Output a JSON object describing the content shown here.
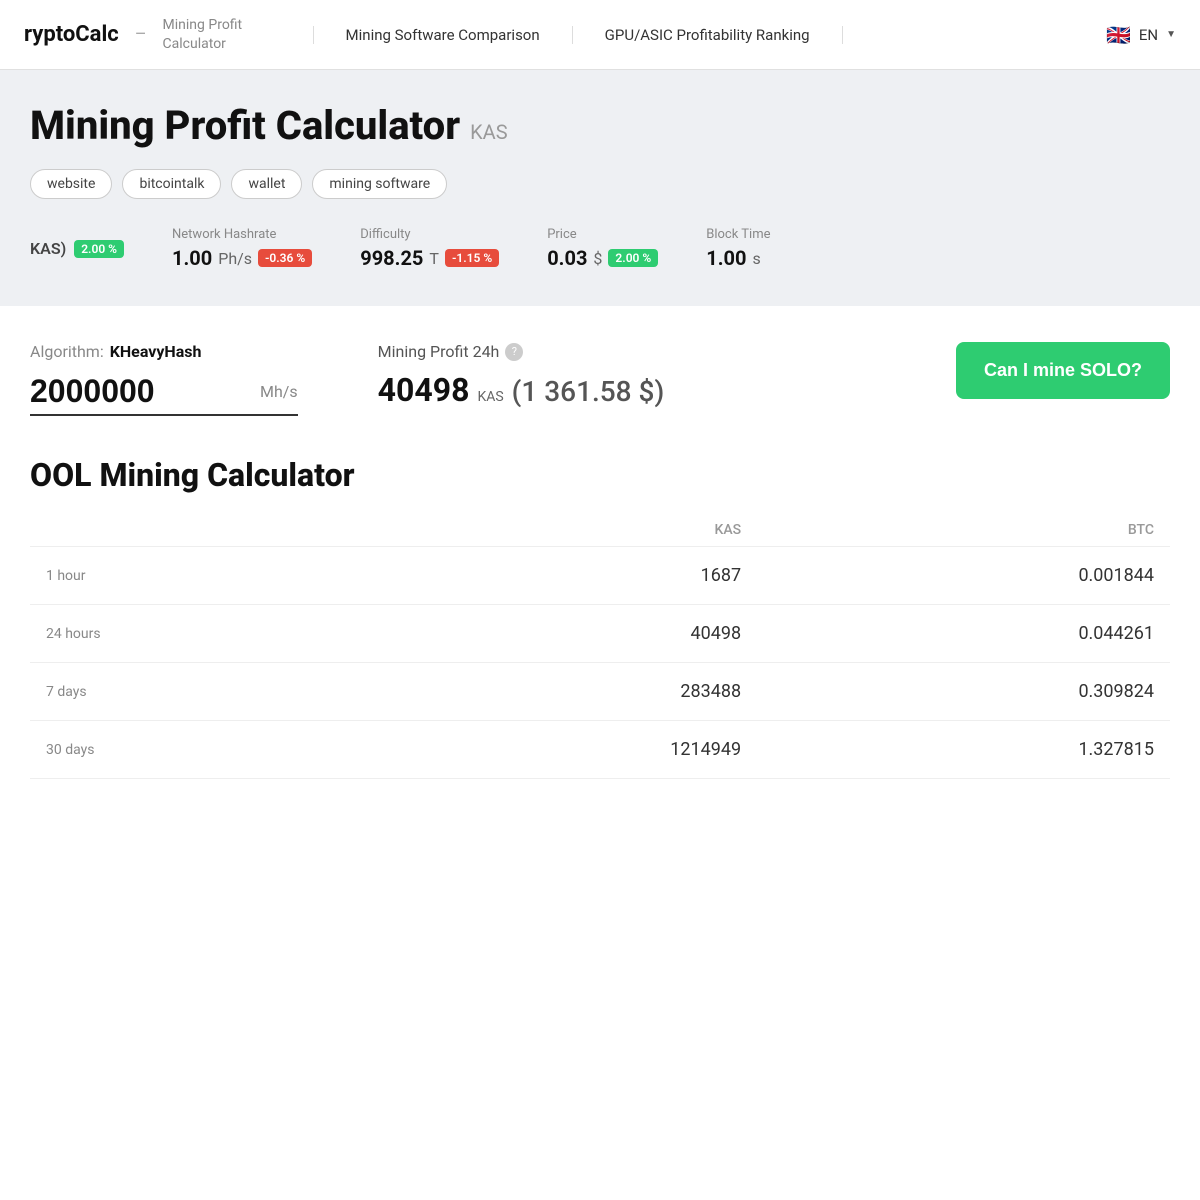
{
  "header": {
    "logo": "ryptoCalc",
    "logo_separator": "–",
    "logo_subtitle": "Mining Profit Calculator",
    "nav": [
      {
        "label": "Mining Software Comparison"
      },
      {
        "label": "GPU/ASIC Profitability Ranking"
      }
    ],
    "lang_code": "EN",
    "lang_flag": "🇬🇧"
  },
  "hero": {
    "title": "Mining Profit Calculator",
    "coin_badge": "KAS",
    "tags": [
      "website",
      "bitcointalk",
      "wallet",
      "mining software"
    ],
    "stats": {
      "coin_label": "KAS)",
      "coin_change": "2.00 %",
      "network_hashrate_label": "Network Hashrate",
      "network_hashrate_value": "1.00",
      "network_hashrate_unit": "Ph/s",
      "network_hashrate_change": "-0.36 %",
      "difficulty_label": "Difficulty",
      "difficulty_value": "998.25",
      "difficulty_unit": "T",
      "difficulty_change": "-1.15 %",
      "price_label": "Price",
      "price_value": "0.03",
      "price_unit": "$",
      "price_change": "2.00 %",
      "block_time_label": "Block Time",
      "block_time_value": "1.00",
      "block_time_unit": "s"
    }
  },
  "calculator": {
    "algorithm_label": "Algorithm:",
    "algorithm_name": "KHeavyHash",
    "profit_label": "Mining Profit 24h",
    "help_icon": "?",
    "hashrate_value": "2000000",
    "hashrate_unit": "Mh/s",
    "profit_amount": "40498",
    "profit_coin": "KAS",
    "profit_usd": "(1 361.58 $)",
    "solo_button_label": "Can I mine SOLO?"
  },
  "pool": {
    "title": "OOL Mining Calculator",
    "columns": [
      "",
      "KAS",
      "BTC"
    ],
    "rows": [
      {
        "period": "",
        "kas": "1687",
        "btc": "0.001844"
      },
      {
        "period": "",
        "kas": "40498",
        "btc": "0.044261"
      },
      {
        "period": "",
        "kas": "283488",
        "btc": "0.309824"
      },
      {
        "period": "",
        "kas": "1214949",
        "btc": "1.327815"
      }
    ]
  }
}
